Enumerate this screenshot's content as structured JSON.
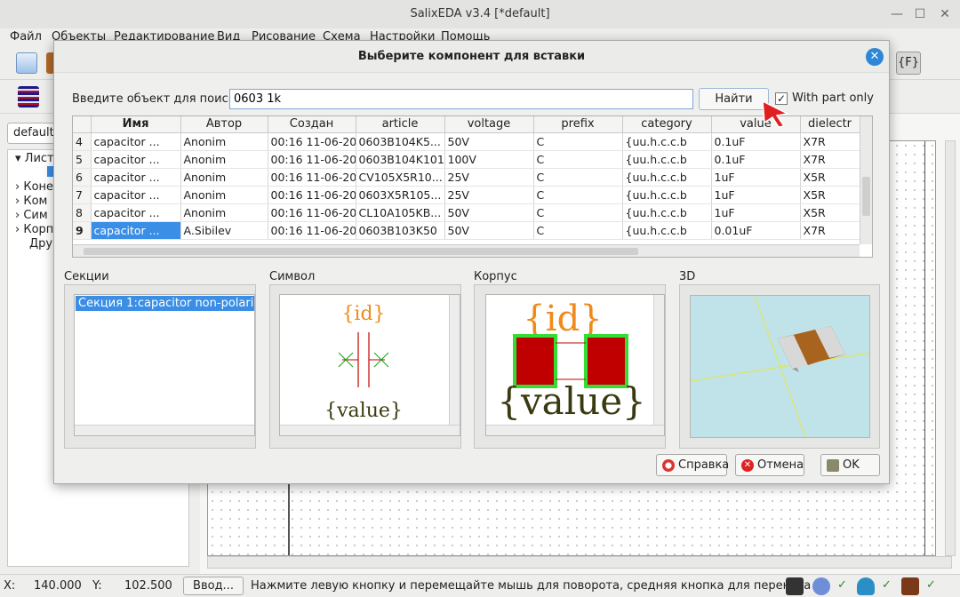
{
  "window": {
    "title": "SalixEDA v3.4 [*default]",
    "menu": [
      "Файл",
      "Объекты",
      "Редактирование",
      "Вид",
      "Рисование",
      "Схема",
      "Настройки",
      "Помощь"
    ]
  },
  "left_panel": {
    "library_combo": "default",
    "tree": [
      "Лист",
      "Коне",
      "Ком",
      "Сим",
      "Корп",
      "Дру"
    ]
  },
  "statusbar": {
    "x_label": "X:",
    "x_value": "140.000",
    "y_label": "Y:",
    "y_value": "102.500",
    "input_button": "Ввод...",
    "hint": "Нажмите левую кнопку и перемещайте мышь для поворота, средняя кнопка для переноса"
  },
  "dialog": {
    "title": "Выберите компонент для вставки",
    "search_label": "Введите объект для поиска:",
    "search_value": "0603 1k",
    "find_button": "Найти",
    "with_part_only_label": "With part only",
    "with_part_only_checked": "✓",
    "columns": [
      "Имя",
      "Автор",
      "Создан",
      "article",
      "voltage",
      "prefix",
      "category",
      "value",
      "dielectr"
    ],
    "rows": [
      {
        "n": "4",
        "name": "capacitor ...",
        "author": "Anonim",
        "created": "00:16 11-06-20",
        "article": "0603B104K5...",
        "voltage": "50V",
        "prefix": "C",
        "category": "{uu.h.c.c.b",
        "value": "0.1uF",
        "dielectric": "X7R"
      },
      {
        "n": "5",
        "name": "capacitor ...",
        "author": "Anonim",
        "created": "00:16 11-06-20",
        "article": "0603B104K101",
        "voltage": "100V",
        "prefix": "C",
        "category": "{uu.h.c.c.b",
        "value": "0.1uF",
        "dielectric": "X7R"
      },
      {
        "n": "6",
        "name": "capacitor ...",
        "author": "Anonim",
        "created": "00:16 11-06-20",
        "article": "CV105X5R10...",
        "voltage": "25V",
        "prefix": "C",
        "category": "{uu.h.c.c.b",
        "value": "1uF",
        "dielectric": "X5R"
      },
      {
        "n": "7",
        "name": "capacitor ...",
        "author": "Anonim",
        "created": "00:16 11-06-20",
        "article": "0603X5R105...",
        "voltage": "25V",
        "prefix": "C",
        "category": "{uu.h.c.c.b",
        "value": "1uF",
        "dielectric": "X5R"
      },
      {
        "n": "8",
        "name": "capacitor ...",
        "author": "Anonim",
        "created": "00:16 11-06-20",
        "article": "CL10A105KB...",
        "voltage": "50V",
        "prefix": "C",
        "category": "{uu.h.c.c.b",
        "value": "1uF",
        "dielectric": "X5R"
      },
      {
        "n": "9",
        "name": "capacitor ...",
        "author": "A.Sibilev",
        "created": "00:16 11-06-20",
        "article": "0603B103K50",
        "voltage": "50V",
        "prefix": "C",
        "category": "{uu.h.c.c.b",
        "value": "0.01uF",
        "dielectric": "X7R"
      }
    ],
    "panels": {
      "sections_label": "Секции",
      "symbol_label": "Символ",
      "package_label": "Корпус",
      "view3d_label": "3D",
      "section_item": "Секция 1:capacitor non-polari",
      "symbol_id": "{id}",
      "symbol_value": "{value}",
      "package_id": "{id}",
      "package_value": "{value}"
    },
    "buttons": {
      "help": "Справка",
      "cancel": "Отмена",
      "ok": "OK"
    },
    "colors": {
      "accent": "#3a8ee6",
      "symbol_id": "#f08a1c",
      "symbol_value": "#4a4a10",
      "pad": "#c00000",
      "pad_border": "#33dd33",
      "view3d_bg": "#bfe3e8"
    }
  }
}
